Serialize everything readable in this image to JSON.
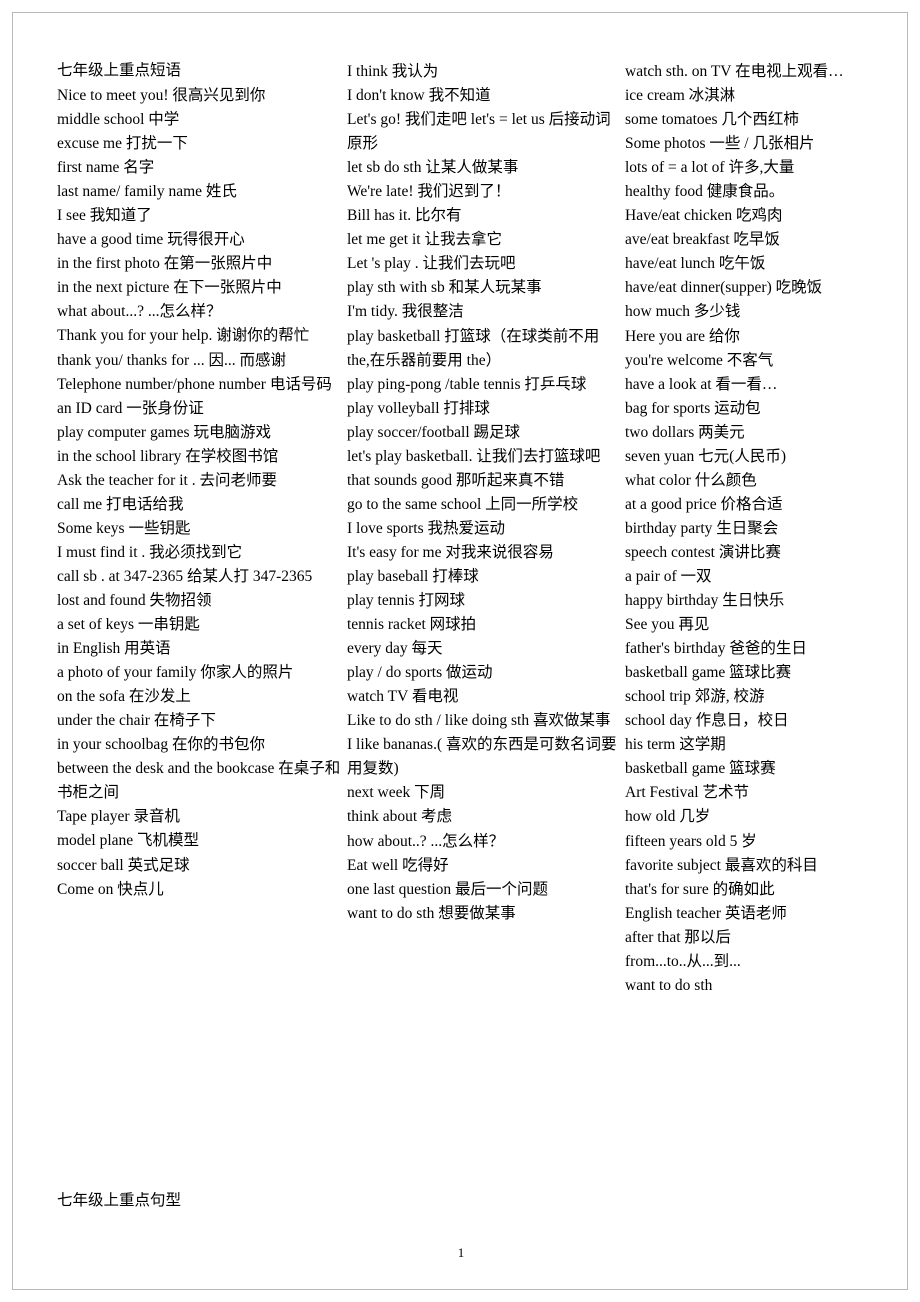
{
  "document": {
    "title": "七年级上重点短语",
    "footer_title": "七年级上重点句型",
    "page_number": "1"
  },
  "columns": [
    {
      "id": "column-1",
      "entries": [
        "Nice to meet you!  很高兴见到你",
        "middle school   中学",
        "excuse me  打扰一下",
        "first name    名字",
        "last name/ family name   姓氏",
        "I see   我知道了",
        "have a good time    玩得很开心",
        "in the first photo  在第一张照片中",
        "in the next picture  在下一张照片中",
        "what about...?   ...怎么样？",
        "Thank you for your help. 谢谢你的帮忙",
        "thank you/ thanks for ...  因... 而感谢",
        "Telephone  number/phone  number 电话号码",
        "an ID card    一张身份证",
        "play computer games 玩电脑游戏",
        "in the school library    在学校图书馆",
        "Ask the teacher for it .  去问老师要",
        "call me  打电话给我",
        "Some keys  一些钥匙",
        "I must find it .   我必须找到它",
        "call sb    .  at 347-2365  给某人打 347-2365",
        "lost and found    失物招领",
        " a set of keys    一串钥匙",
        "in English   用英语",
        "a photo of your family    你家人的照片",
        "on the sofa   在沙发上",
        "under the chair   在椅子下",
        "in your schoolbag   在你的书包你",
        "between the desk and the bookcase 在桌子和书柜之间",
        "Tape player    录音机",
        "model plane    飞机模型",
        "soccer ball   英式足球",
        "Come on   快点儿"
      ]
    },
    {
      "id": "column-2",
      "entries": [
        "I think  我认为",
        "I don't know    我不知道",
        "Let's go! 我们走吧    let's = let us 后接动词原形",
        "let sb do sth  让某人做某事",
        "We're late! 我们迟到了！",
        "Bill has it. 比尔有",
        "let me get it 让我去拿它",
        "Let 's play . 让我们去玩吧",
        "play sth with sb   和某人玩某事",
        "I'm tidy. 我很整洁",
        "play basketball  打篮球（在球类前不用 the,在乐器前要用 the）",
        "play ping-pong /table tennis  打乒乓球",
        "play volleyball    打排球",
        "play soccer/football    踢足球",
        "let's play basketball. 让我们去打篮球吧",
        "that sounds good  那听起来真不错",
        "go to the same school   上同一所学校",
        "I love sports    我热爱运动",
        "It's easy for me  对我来说很容易",
        "play baseball  打棒球",
        "play tennis  打网球",
        "tennis racket  网球拍",
        "every day    每天",
        "play / do sports 做运动",
        "watch TV   看电视",
        "Like to do sth / like doing sth   喜欢做某事",
        "I like bananas.( 喜欢的东西是可数名词要用复数)",
        "next week  下周",
        "think about  考虑",
        "how about..?   ...怎么样？",
        "Eat well  吃得好",
        "one last question  最后一个问题",
        "want to do sth  想要做某事"
      ]
    },
    {
      "id": "column-3",
      "entries": [
        "watch sth. on TV    在电视上观看…",
        "ice cream    冰淇淋",
        "some tomatoes    几个西红柿",
        "Some photos    一些 / 几张相片",
        "lots of = a lot of    许多,大量",
        "healthy food 健康食品。",
        "Have/eat chicken  吃鸡肉",
        "ave/eat breakfast  吃早饭",
        "have/eat lunch       吃午饭",
        "have/eat dinner(supper)  吃晚饭",
        "how much  多少钱",
        "Here you are    给你",
        "you're welcome   不客气",
        "have a look at    看一看…",
        "bag for sports 运动包",
        "two dollars    两美元",
        "seven yuan    七元(人民币)",
        "what color  什么颜色",
        "at a good price 价格合适",
        "birthday party    生日聚会",
        "speech contest   演讲比赛",
        "a pair of    一双",
        "happy birthday  生日快乐",
        "See you  再见",
        "father's birthday  爸爸的生日",
        "basketball game  篮球比赛",
        "school trip 郊游, 校游",
        "school day   作息日，校日",
        "his term 这学期",
        "basketball game  篮球赛",
        "Art Festival  艺术节",
        "how old  几岁",
        "fifteen years old 5 岁",
        "favorite subject  最喜欢的科目",
        "that's for sure  的确如此",
        "English teacher  英语老师",
        "after that    那以后",
        "from...to..从...到...",
        "want to do sth"
      ]
    }
  ]
}
